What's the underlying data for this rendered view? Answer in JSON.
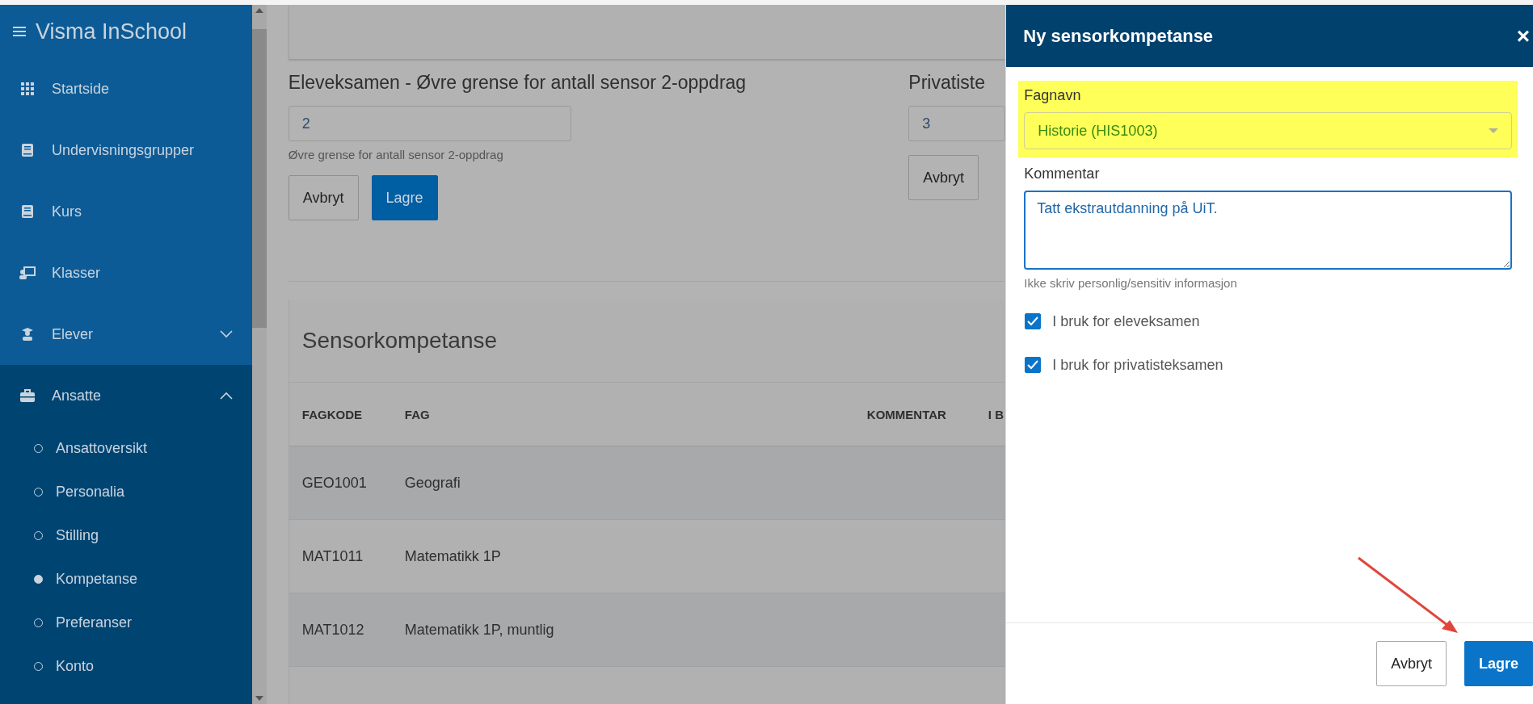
{
  "sidebar": {
    "title": "Visma InSchool",
    "items": [
      {
        "label": "Startside",
        "kind": "link",
        "expanded": false
      },
      {
        "label": "Undervisningsgrupper",
        "kind": "link",
        "expanded": false
      },
      {
        "label": "Kurs",
        "kind": "link",
        "expanded": false
      },
      {
        "label": "Klasser",
        "kind": "link",
        "expanded": false
      },
      {
        "label": "Elever",
        "kind": "group",
        "expanded": false
      },
      {
        "label": "Ansatte",
        "kind": "group",
        "expanded": true,
        "children": [
          {
            "label": "Ansattoversikt",
            "selected": false
          },
          {
            "label": "Personalia",
            "selected": false
          },
          {
            "label": "Stilling",
            "selected": false
          },
          {
            "label": "Kompetanse",
            "selected": true
          },
          {
            "label": "Preferanser",
            "selected": false
          },
          {
            "label": "Konto",
            "selected": false
          }
        ]
      }
    ]
  },
  "settings": [
    {
      "title": "Eleveksamen - Øvre grense for antall sensor 2-oppdrag",
      "value": "2",
      "help": "Øvre grense for antall sensor 2-oppdrag",
      "buttons": [
        {
          "label": "Avbryt",
          "kind": "secondary"
        },
        {
          "label": "Lagre",
          "kind": "primary"
        }
      ]
    },
    {
      "title": "Privatiste",
      "value": "3",
      "buttons": [
        {
          "label": "Avbryt",
          "kind": "secondary"
        }
      ]
    }
  ],
  "table": {
    "title": "Sensorkompetanse",
    "columns": [
      "FAGKODE",
      "FAG",
      "KOMMENTAR",
      "I B"
    ],
    "rows": [
      {
        "code": "GEO1001",
        "subject": "Geografi"
      },
      {
        "code": "MAT1011",
        "subject": "Matematikk 1P"
      },
      {
        "code": "MAT1012",
        "subject": "Matematikk 1P, muntlig"
      }
    ]
  },
  "panel": {
    "title": "Ny sensorkompetanse",
    "close": "×",
    "fields": [
      {
        "kind": "select",
        "label": "Fagnavn",
        "value": "Historie (HIS1003)",
        "highlighted": true
      },
      {
        "kind": "textarea",
        "label": "Kommentar",
        "value": "Tatt ekstrautdanning på UiT.",
        "help": "Ikke skriv personlig/sensitiv informasjon",
        "highlighted": false
      }
    ],
    "checkboxes": [
      {
        "label": "I bruk for eleveksamen",
        "checked": true
      },
      {
        "label": "I bruk for privatisteksamen",
        "checked": true
      }
    ],
    "buttons": [
      {
        "label": "Avbryt",
        "kind": "secondary"
      },
      {
        "label": "Lagre",
        "kind": "primary"
      }
    ]
  }
}
